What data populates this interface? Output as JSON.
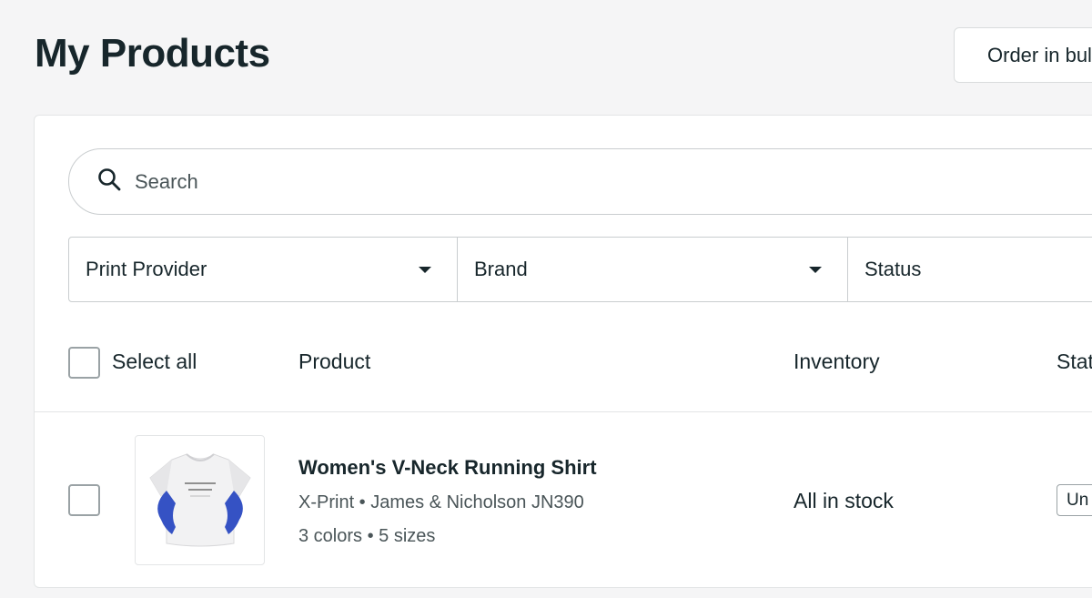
{
  "header": {
    "title": "My Products",
    "bulk_order_label": "Order in bulk"
  },
  "search": {
    "placeholder": "Search"
  },
  "filters": [
    {
      "label": "Print Provider"
    },
    {
      "label": "Brand"
    },
    {
      "label": "Status"
    }
  ],
  "table": {
    "select_all_label": "Select all",
    "columns": [
      "Product",
      "Inventory",
      "Status"
    ],
    "rows": [
      {
        "name": "Women's V-Neck Running Shirt",
        "provider_brand": "X-Print • James & Nicholson JN390",
        "variants": "3 colors • 5 sizes",
        "inventory": "All in stock",
        "status": "Un"
      }
    ]
  },
  "colors": {
    "background": "#f5f5f6",
    "text": "#17262b",
    "shirt_accent": "#3552c4"
  },
  "icons": {
    "search": "search-icon",
    "dropdown": "chevron-down-icon"
  }
}
